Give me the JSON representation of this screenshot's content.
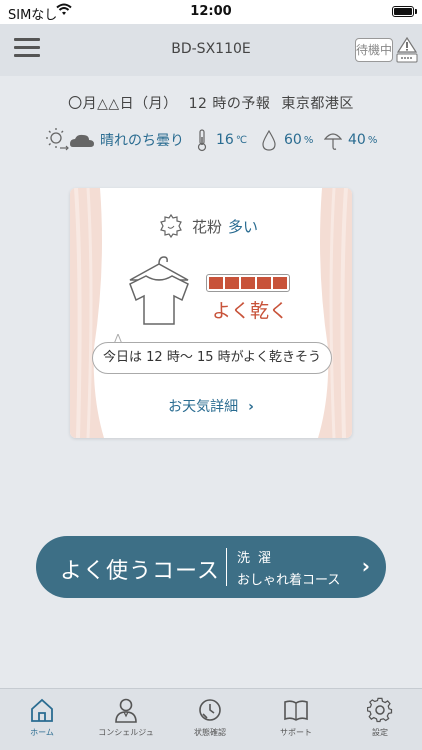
{
  "status_bar": {
    "carrier": "SIMなし",
    "time": "12:00"
  },
  "header": {
    "device_name": "BD-SX110E",
    "standby_label": "待機中"
  },
  "forecast": {
    "date": "〇月△△日（月）",
    "hour": "12 時の予報",
    "location": "東京都港区",
    "weather": "晴れのち曇り",
    "temperature": "16",
    "temperature_unit": "℃",
    "humidity": "60",
    "humidity_unit": "%",
    "rain_chance": "40",
    "rain_unit": "%"
  },
  "laundry_card": {
    "pollen_label": "花粉",
    "pollen_value": "多い",
    "drying_level": 5,
    "drying_label": "よく乾く",
    "bubble_text": "今日は 12 時〜 15 時がよく乾きそう",
    "detail_link": "お天気詳細"
  },
  "course_button": {
    "label": "よく使うコース",
    "sub_line1": "洗濯",
    "sub_line2": "おしゃれ着コース"
  },
  "tabs": [
    {
      "label": "ホーム",
      "icon": "home-icon",
      "active": true
    },
    {
      "label": "コンシェルジュ",
      "icon": "concierge-icon"
    },
    {
      "label": "状態確認",
      "icon": "status-icon"
    },
    {
      "label": "サポート",
      "icon": "book-icon"
    },
    {
      "label": "設定",
      "icon": "gear-icon"
    }
  ],
  "colors": {
    "accent": "#2a6c91",
    "drying": "#c8533a",
    "course_button": "#3d6f86",
    "background": "#e6e9ed"
  }
}
